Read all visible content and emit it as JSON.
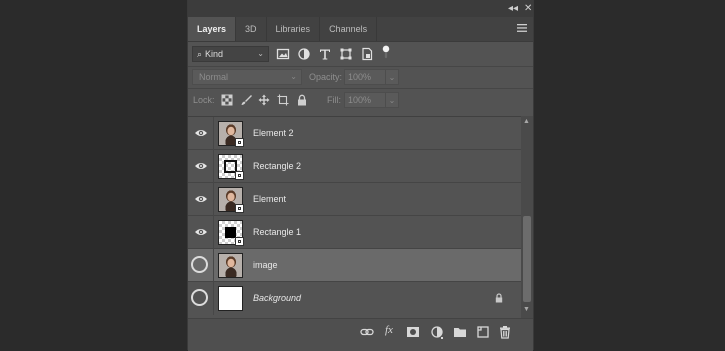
{
  "window": {
    "collapse_glyph": "◂◂",
    "close_glyph": "✕"
  },
  "tabs": [
    {
      "label": "Layers",
      "active": true
    },
    {
      "label": "3D",
      "active": false
    },
    {
      "label": "Libraries",
      "active": false
    },
    {
      "label": "Channels",
      "active": false
    }
  ],
  "filter": {
    "kind_label": "Kind",
    "search_glyph": "⌕",
    "icons": [
      "image-filter-icon",
      "adjustment-filter-icon",
      "type-filter-icon",
      "shape-filter-icon",
      "smart-object-filter-icon",
      "filter-toggle-icon"
    ]
  },
  "blend": {
    "mode": "Normal",
    "opacity_label": "Opacity:",
    "opacity_value": "100%"
  },
  "lock": {
    "label": "Lock:",
    "fill_label": "Fill:",
    "fill_value": "100%",
    "icons": [
      "lock-transparent-icon",
      "lock-paint-icon",
      "lock-position-icon",
      "lock-artboard-icon",
      "lock-all-icon"
    ]
  },
  "layers": [
    {
      "name": "Element 2",
      "thumb": "photo",
      "visible": true,
      "selected": false,
      "smart": true,
      "italic": false,
      "locked": false
    },
    {
      "name": "Rectangle 2",
      "thumb": "rect2",
      "visible": true,
      "selected": false,
      "smart": true,
      "italic": false,
      "locked": false
    },
    {
      "name": "Element",
      "thumb": "photo",
      "visible": true,
      "selected": false,
      "smart": true,
      "italic": false,
      "locked": false
    },
    {
      "name": "Rectangle 1",
      "thumb": "rect1",
      "visible": true,
      "selected": false,
      "smart": true,
      "italic": false,
      "locked": false
    },
    {
      "name": "image",
      "thumb": "photo",
      "visible": false,
      "selected": true,
      "smart": false,
      "italic": false,
      "locked": false
    },
    {
      "name": "Background",
      "thumb": "white",
      "visible": false,
      "selected": false,
      "smart": false,
      "italic": true,
      "locked": true
    }
  ],
  "bottom": {
    "fx_label": "fx",
    "icons": [
      "link-layers-icon",
      "fx-icon",
      "add-mask-icon",
      "new-adjustment-icon",
      "new-group-icon",
      "new-layer-icon",
      "delete-layer-icon"
    ]
  }
}
